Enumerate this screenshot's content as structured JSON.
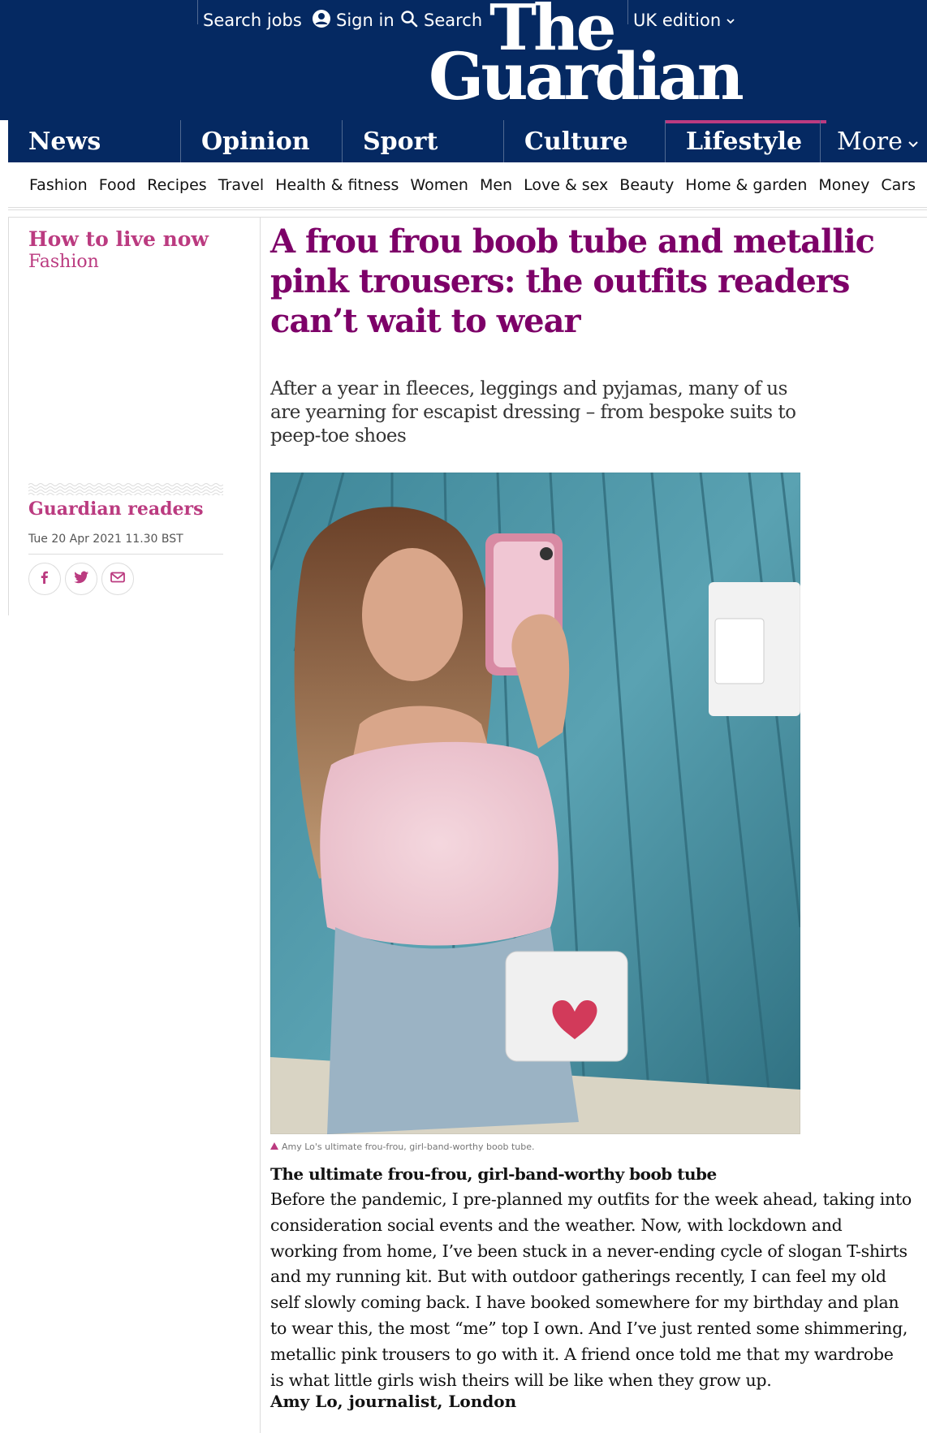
{
  "header": {
    "search_jobs": "Search jobs",
    "sign_in": "Sign in",
    "search": "Search",
    "edition": "UK edition",
    "logo_line1": "The",
    "logo_line2": "Guardian"
  },
  "pillars": {
    "news": "News",
    "opinion": "Opinion",
    "sport": "Sport",
    "culture": "Culture",
    "lifestyle": "Lifestyle",
    "more": "More"
  },
  "subnav": [
    "Fashion",
    "Food",
    "Recipes",
    "Travel",
    "Health & fitness",
    "Women",
    "Men",
    "Love & sex",
    "Beauty",
    "Home & garden",
    "Money",
    "Cars"
  ],
  "meta": {
    "series": "How to live now",
    "section": "Fashion",
    "byline": "Guardian readers",
    "date": "Tue 20 Apr 2021 11.30 BST"
  },
  "article": {
    "headline": "A frou frou boob tube and metallic pink trousers: the outfits readers can’t wait to wear",
    "standfirst": "After a year in fleeces, leggings and pyjamas, many of us are yearning for escapist dressing – from bespoke suits to peep-toe shoes",
    "caption": "Amy Lo's ultimate frou-frou, girl-band-worthy boob tube.",
    "subhead": "The ultimate frou-frou, girl-band-worthy boob tube",
    "body": "Before the pandemic, I pre-planned my outfits for the week ahead, taking into consideration social events and the weather. Now, with lockdown and working from home, I’ve been stuck in a never-ending cycle of slogan T-shirts and my running kit. But with outdoor gatherings recently, I can feel my old self slowly coming back. I have booked somewhere for my birthday and plan to wear this, the most “me” top I own. And I’ve just rented some shimmering, metallic pink trousers to go with it. A friend once told me that my wardrobe is what little girls wish theirs will be like when they grow up.",
    "signoff": "Amy Lo, journalist, London"
  },
  "colors": {
    "brand_blue": "#052962",
    "lifestyle_pink": "#bb3b80",
    "headline_purple": "#7d0068"
  },
  "icons": [
    "user-icon",
    "search-icon",
    "chevron-down-icon",
    "facebook-icon",
    "twitter-icon",
    "email-icon",
    "caption-triangle-icon"
  ]
}
